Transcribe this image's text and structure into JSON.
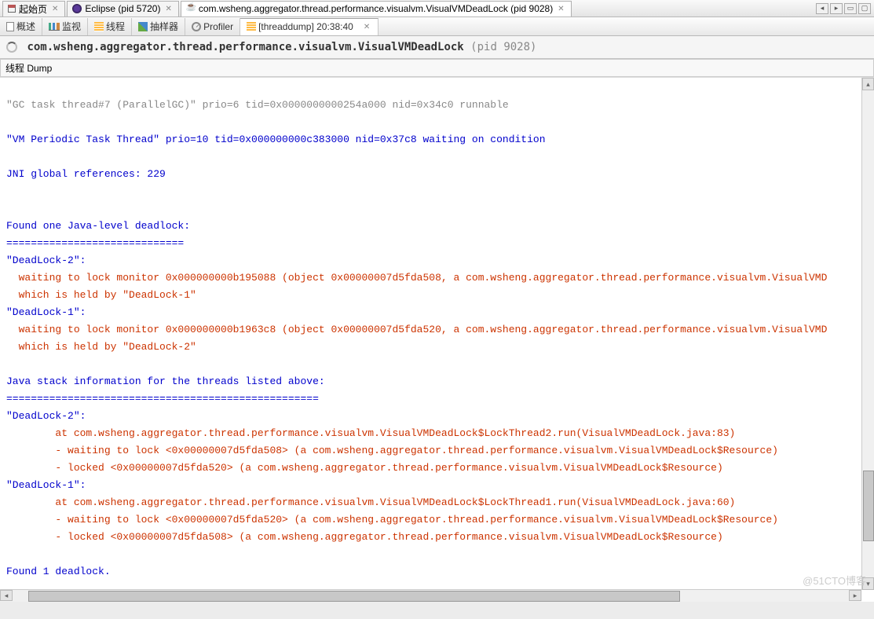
{
  "top_tabs": {
    "start": "起始页",
    "eclipse": "Eclipse (pid 5720)",
    "app": "com.wsheng.aggregator.thread.performance.visualvm.VisualVMDeadLock (pid 9028)"
  },
  "toolbar": {
    "overview": "概述",
    "monitor": "监视",
    "threads": "线程",
    "sampler": "抽样器",
    "profiler": "Profiler",
    "threaddump_tab": "[threaddump] 20:38:40"
  },
  "header": {
    "title_bold": "com.wsheng.aggregator.thread.performance.visualvm.VisualVMDeadLock",
    "title_pid": "(pid 9028)"
  },
  "subheader": "线程 Dump",
  "dump": {
    "truncated": "\"GC task thread#7 (ParallelGC)\" prio=6 tid=0x0000000000254a000 nid=0x34c0 runnable",
    "l1": "\"VM Periodic Task Thread\" prio=10 tid=0x000000000c383000 nid=0x37c8 waiting on condition",
    "l2": "JNI global references: 229",
    "l3": "Found one Java-level deadlock:",
    "l4": "=============================",
    "d2a": "\"DeadLock-2\":",
    "d2b": "  waiting to lock monitor 0x000000000b195088 (object 0x00000007d5fda508, a com.wsheng.aggregator.thread.performance.visualvm.VisualVMD",
    "d2c": "  which is held by \"DeadLock-1\"",
    "d1a": "\"DeadLock-1\":",
    "d1b": "  waiting to lock monitor 0x000000000b1963c8 (object 0x00000007d5fda520, a com.wsheng.aggregator.thread.performance.visualvm.VisualVMD",
    "d1c": "  which is held by \"DeadLock-2\"",
    "si1": "Java stack information for the threads listed above:",
    "si2": "===================================================",
    "s2a": "\"DeadLock-2\":",
    "s2b": "        at com.wsheng.aggregator.thread.performance.visualvm.VisualVMDeadLock$LockThread2.run(VisualVMDeadLock.java:83)",
    "s2c": "        - waiting to lock <0x00000007d5fda508> (a com.wsheng.aggregator.thread.performance.visualvm.VisualVMDeadLock$Resource)",
    "s2d": "        - locked <0x00000007d5fda520> (a com.wsheng.aggregator.thread.performance.visualvm.VisualVMDeadLock$Resource)",
    "s1a": "\"DeadLock-1\":",
    "s1b": "        at com.wsheng.aggregator.thread.performance.visualvm.VisualVMDeadLock$LockThread1.run(VisualVMDeadLock.java:60)",
    "s1c": "        - waiting to lock <0x00000007d5fda520> (a com.wsheng.aggregator.thread.performance.visualvm.VisualVMDeadLock$Resource)",
    "s1d": "        - locked <0x00000007d5fda508> (a com.wsheng.aggregator.thread.performance.visualvm.VisualVMDeadLock$Resource)",
    "found": "Found 1 deadlock."
  },
  "watermark": "@51CTO博客"
}
